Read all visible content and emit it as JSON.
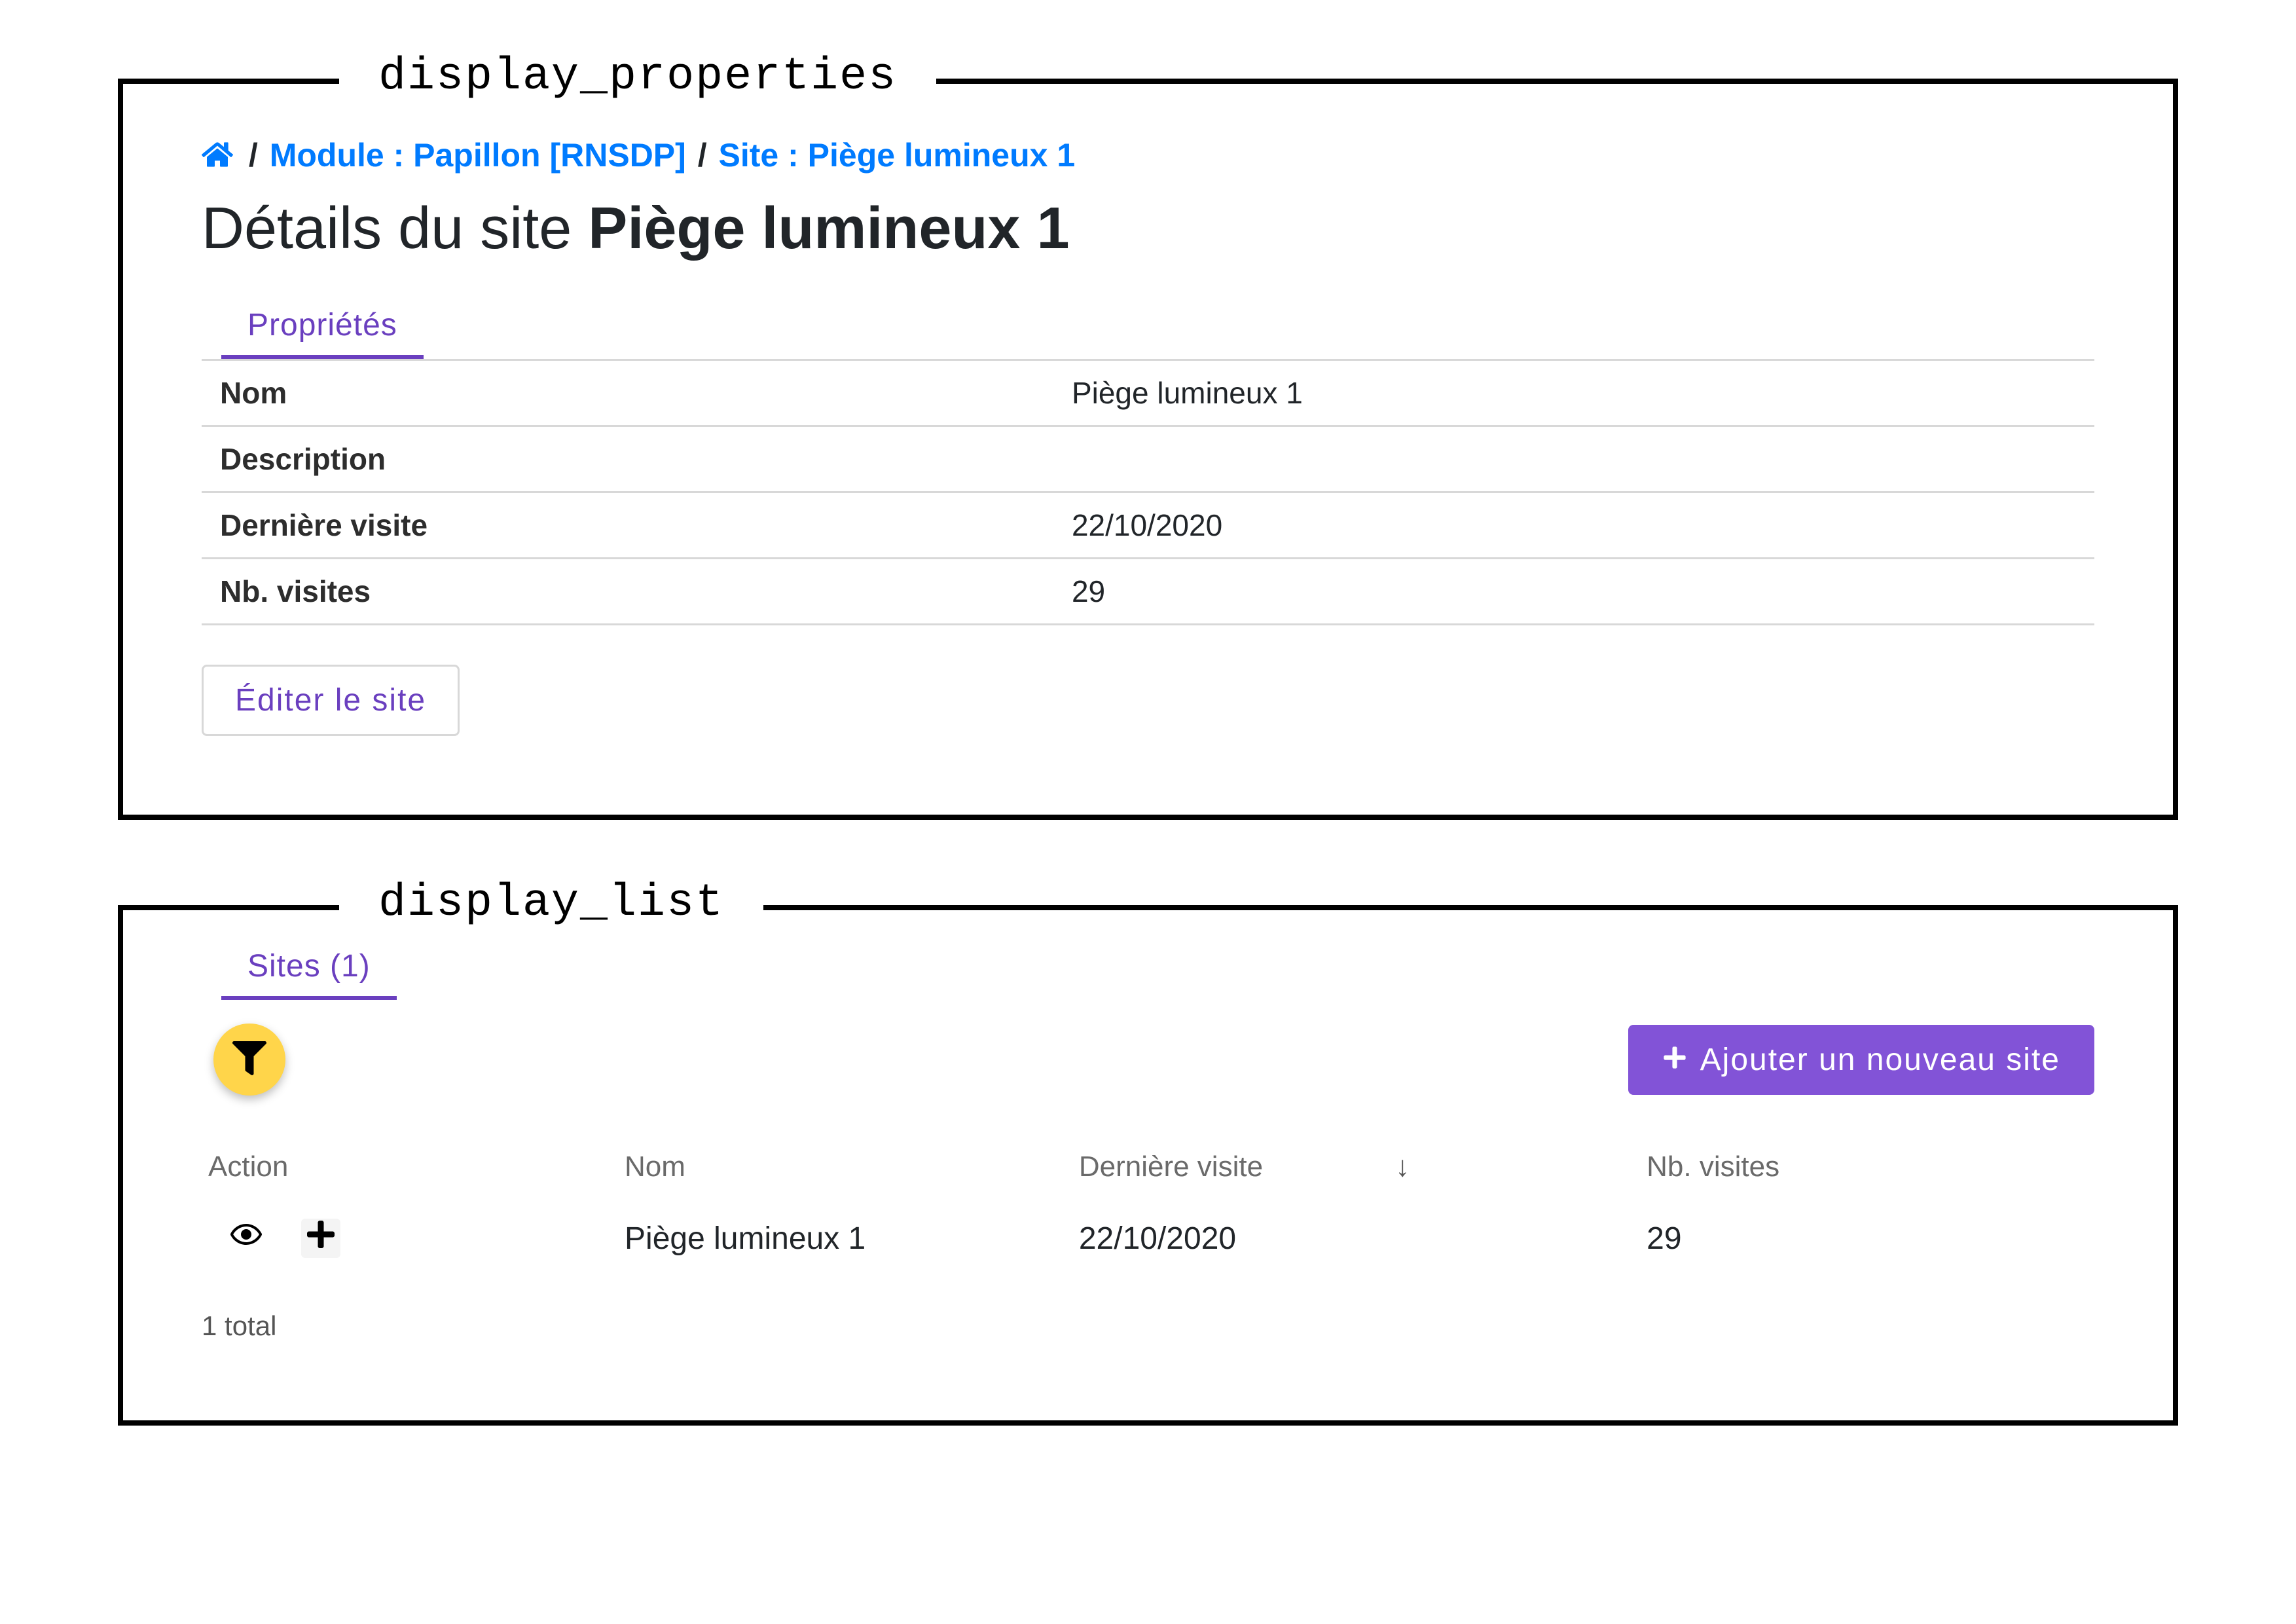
{
  "panels": {
    "properties_label": "display_properties",
    "list_label": "display_list"
  },
  "breadcrumb": {
    "module": "Module : Papillon [RNSDP]",
    "site": "Site : Piège lumineux 1"
  },
  "title": {
    "prefix": "Détails du site",
    "name": "Piège lumineux 1"
  },
  "tabs": {
    "properties": "Propriétés",
    "sites": "Sites (1)"
  },
  "properties": {
    "rows": [
      {
        "label": "Nom",
        "value": "Piège lumineux 1"
      },
      {
        "label": "Description",
        "value": ""
      },
      {
        "label": "Dernière visite",
        "value": "22/10/2020"
      },
      {
        "label": "Nb. visites",
        "value": "29"
      }
    ],
    "edit_label": "Éditer le site"
  },
  "list": {
    "add_label": "Ajouter un nouveau site",
    "columns": {
      "action": "Action",
      "name": "Nom",
      "last_visit": "Dernière visite",
      "nb": "Nb. visites"
    },
    "rows": [
      {
        "name": "Piège lumineux 1",
        "last_visit": "22/10/2020",
        "nb": "29"
      }
    ],
    "total": "1 total"
  }
}
